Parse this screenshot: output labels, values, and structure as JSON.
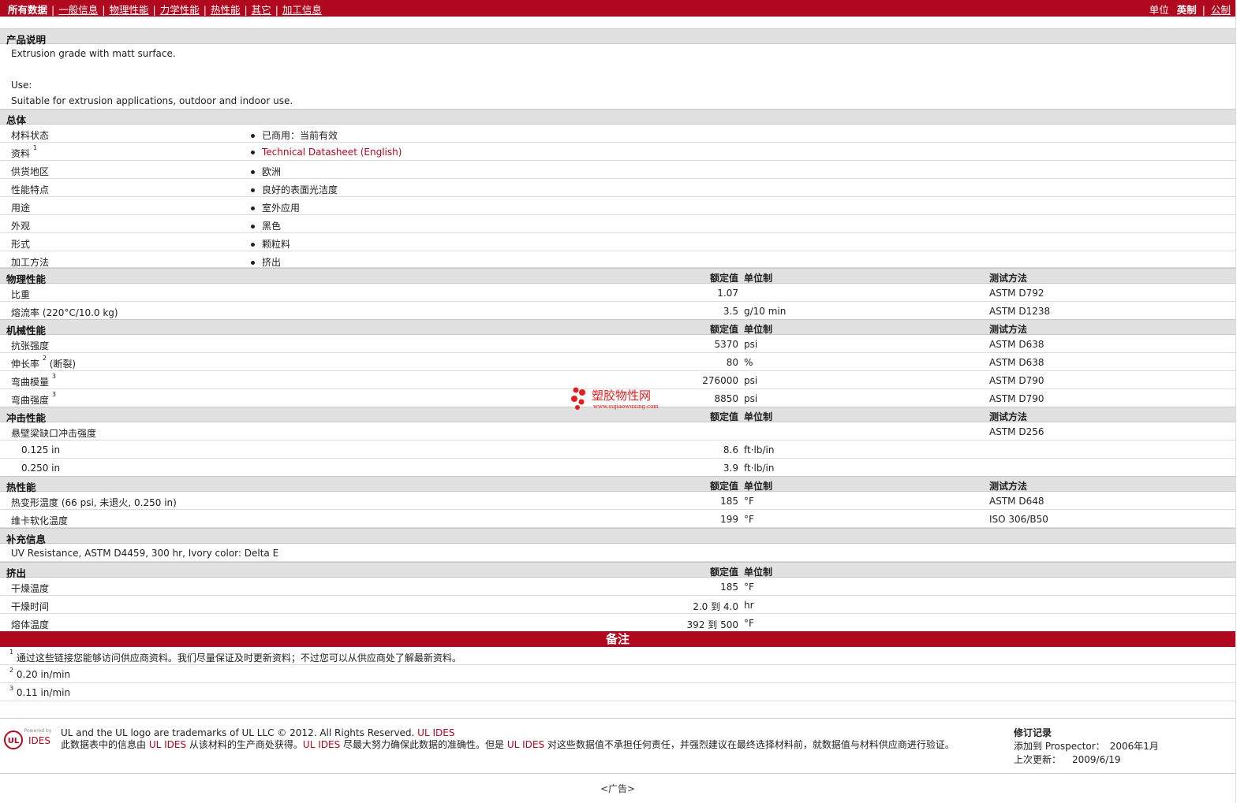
{
  "nav": {
    "items": [
      {
        "label": "所有数据",
        "current": true
      },
      {
        "label": "一般信息"
      },
      {
        "label": "物理性能"
      },
      {
        "label": "力学性能"
      },
      {
        "label": "热性能"
      },
      {
        "label": "其它"
      },
      {
        "label": "加工信息"
      }
    ],
    "units_label": "单位",
    "units_current": "英制",
    "units_other": "公制"
  },
  "description": {
    "title": "产品说明",
    "line1": "Extrusion grade with matt surface.",
    "line2": "Use:",
    "line3": "Suitable for extrusion applications, outdoor and indoor use."
  },
  "general": {
    "title": "总体",
    "rows": [
      {
        "label": "材料状态",
        "value": "已商用：当前有效"
      },
      {
        "label": "资料",
        "sup": "1",
        "value": "Technical Datasheet (English)",
        "link": true
      },
      {
        "label": "供货地区",
        "value": "欧洲"
      },
      {
        "label": "性能特点",
        "value": "良好的表面光洁度"
      },
      {
        "label": "用途",
        "value": "室外应用"
      },
      {
        "label": "外观",
        "value": "黑色"
      },
      {
        "label": "形式",
        "value": "颗粒料"
      },
      {
        "label": "加工方法",
        "value": "挤出"
      }
    ]
  },
  "headers": {
    "value": "额定值",
    "unit": "单位制",
    "method": "测试方法"
  },
  "physical": {
    "title": "物理性能",
    "rows": [
      {
        "label": "比重",
        "value": "1.07",
        "unit": "",
        "method": "ASTM D792"
      },
      {
        "label": "熔流率 (220°C/10.0 kg)",
        "value": "3.5",
        "unit": "g/10 min",
        "method": "ASTM D1238"
      }
    ]
  },
  "mechanical": {
    "title": "机械性能",
    "rows": [
      {
        "label": "抗张强度",
        "value": "5370",
        "unit": "psi",
        "method": "ASTM D638"
      },
      {
        "label": "伸长率",
        "sup": "2",
        "suffix": " (断裂)",
        "value": "80",
        "unit": "%",
        "method": "ASTM D638"
      },
      {
        "label": "弯曲模量",
        "sup": "3",
        "value": "276000",
        "unit": "psi",
        "method": "ASTM D790"
      },
      {
        "label": "弯曲强度",
        "sup": "3",
        "value": "8850",
        "unit": "psi",
        "method": "ASTM D790"
      }
    ]
  },
  "impact": {
    "title": "冲击性能",
    "rows": [
      {
        "label": "悬壁梁缺口冲击强度",
        "value": "",
        "unit": "",
        "method": "ASTM D256"
      },
      {
        "label": "0.125 in",
        "indent": true,
        "value": "8.6",
        "unit": "ft·lb/in",
        "method": ""
      },
      {
        "label": "0.250 in",
        "indent": true,
        "value": "3.9",
        "unit": "ft·lb/in",
        "method": ""
      }
    ]
  },
  "thermal": {
    "title": "热性能",
    "rows": [
      {
        "label": "热变形温度 (66 psi, 未退火, 0.250 in)",
        "value": "185",
        "unit": "°F",
        "method": "ASTM D648"
      },
      {
        "label": "维卡软化温度",
        "value": "199",
        "unit": "°F",
        "method": "ISO 306/B50"
      }
    ]
  },
  "supplement": {
    "title": "补充信息",
    "text": "UV Resistance, ASTM D4459, 300 hr, Ivory color: Delta E"
  },
  "extrusion": {
    "title": "挤出",
    "rows": [
      {
        "label": "干燥温度",
        "value": "185",
        "unit": "°F"
      },
      {
        "label": "干燥时间",
        "value": "2.0 到  4.0",
        "unit": "hr"
      },
      {
        "label": "熔体温度",
        "value": "392 到  500",
        "unit": "°F"
      }
    ]
  },
  "notes": {
    "title": "备注",
    "items": [
      {
        "sup": "1",
        "text": "通过这些链接您能够访问供应商资料。我们尽量保证及时更新资料；不过您可以从供应商处了解最新资料。"
      },
      {
        "sup": "2",
        "text": "0.20 in/min"
      },
      {
        "sup": "3",
        "text": "0.11 in/min"
      }
    ]
  },
  "footer": {
    "powered": "Powered by",
    "logo_text": "IDES",
    "line1_a": "UL and the UL logo are trademarks of UL LLC © 2012. All Rights Reserved. ",
    "line1_link": "UL IDES",
    "line2_a": "此数据表中的信息由 ",
    "line2_link1": "UL IDES",
    "line2_b": " 从该材料的生产商处获得。",
    "line2_link2": "UL IDES",
    "line2_c": " 尽最大努力确保此数据的准确性。但是 ",
    "line2_link3": "UL IDES",
    "line2_d": " 对这些数据值不承担任何责任，并强烈建议在最终选择材料前，就数据值与材料供应商进行验证。",
    "rev_title": "修订记录",
    "rev_added_label": "添加到  Prospector：",
    "rev_added": "2006年1月",
    "rev_updated_label": "上次更新：",
    "rev_updated": "2009/6/19"
  },
  "watermark": {
    "cn": "塑胶物性网",
    "url": "www.sujiaowuxing.com"
  },
  "ad": "<广告>",
  "colors": {
    "brand": "#b0081f",
    "section_bg": "#e1e1e1"
  }
}
